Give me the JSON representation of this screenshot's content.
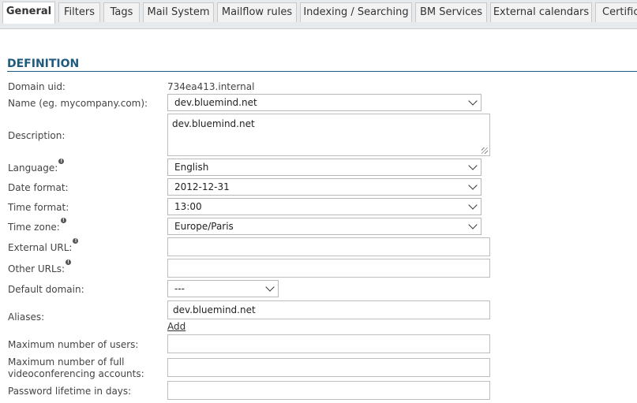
{
  "tabs": [
    {
      "label": "General",
      "active": true
    },
    {
      "label": "Filters"
    },
    {
      "label": "Tags"
    },
    {
      "label": "Mail System"
    },
    {
      "label": "Mailflow rules"
    },
    {
      "label": "Indexing / Searching"
    },
    {
      "label": "BM Services"
    },
    {
      "label": "External calendars"
    },
    {
      "label": "Certific"
    }
  ],
  "section": {
    "title": "DEFINITION"
  },
  "form": {
    "domain_uid": {
      "label": "Domain uid:",
      "value": "734ea413.internal"
    },
    "name": {
      "label": "Name (eg. mycompany.com):",
      "value": "dev.bluemind.net"
    },
    "description": {
      "label": "Description:",
      "value": "dev.bluemind.net"
    },
    "language": {
      "label": "Language:",
      "value": "English"
    },
    "date_format": {
      "label": "Date format:",
      "value": "2012-12-31"
    },
    "time_format": {
      "label": "Time format:",
      "value": "13:00"
    },
    "time_zone": {
      "label": "Time zone:",
      "value": "Europe/Paris"
    },
    "external_url": {
      "label": "External URL:",
      "value": ""
    },
    "other_urls": {
      "label": "Other URLs:",
      "value": ""
    },
    "default_domain": {
      "label": "Default domain:",
      "value": "---"
    },
    "aliases": {
      "label": "Aliases:",
      "value": "dev.bluemind.net",
      "add_label": "Add"
    },
    "max_users": {
      "label": "Maximum number of users:",
      "value": ""
    },
    "max_video": {
      "label": "Maximum number of full videoconferencing accounts:",
      "value": ""
    },
    "password_lifetime": {
      "label": "Password lifetime in days:",
      "value": ""
    }
  },
  "info_icon": "info-icon"
}
